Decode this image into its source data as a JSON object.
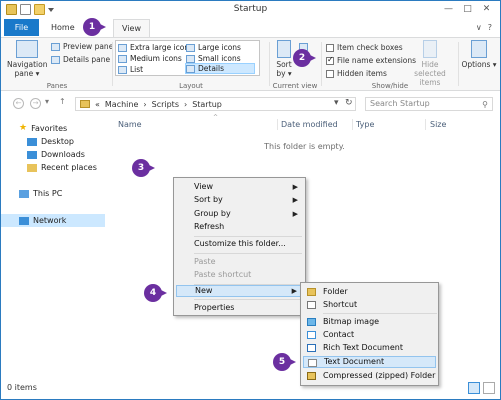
{
  "window": {
    "title": "Startup",
    "controls": {
      "minimize": "—",
      "maximize": "□",
      "close": "✕"
    }
  },
  "tabs": {
    "file": "File",
    "home": "Home",
    "view": "View"
  },
  "tabrow_right": {
    "collapse": "∨",
    "help": "?"
  },
  "ribbon": {
    "panes": {
      "label": "Panes",
      "navigation_pane": "Navigation pane",
      "navigation_pane_arrow": "▾",
      "preview_pane": "Preview pane",
      "details_pane": "Details pane"
    },
    "layout": {
      "label": "Layout",
      "extra_large_icons": "Extra large icons",
      "large_icons": "Large icons",
      "medium_icons": "Medium icons",
      "small_icons": "Small icons",
      "list": "List",
      "details": "Details"
    },
    "current_view": {
      "label": "Current view",
      "sort_by": "Sort by",
      "sort_arrow": "▾"
    },
    "show_hide": {
      "label": "Show/hide",
      "item_check_boxes": "Item check boxes",
      "file_name_extensions": "File name extensions",
      "hidden_items": "Hidden items",
      "hide_selected_items": "Hide selected items"
    },
    "options": {
      "label": "Options",
      "arrow": "▾"
    }
  },
  "address": {
    "back": "←",
    "forward": "→",
    "recent": "▾",
    "up": "↑",
    "chevron": "«",
    "crumbs": [
      "Machine",
      "Scripts",
      "Startup"
    ],
    "crumb_sep": "›",
    "dropdown": "▾",
    "refresh": "↻",
    "search_placeholder": "Search Startup",
    "search_icon": "⚲"
  },
  "nav": {
    "star": "★",
    "favorites": "Favorites",
    "desktop": "Desktop",
    "downloads": "Downloads",
    "recent_places": "Recent places",
    "this_pc": "This PC",
    "network": "Network"
  },
  "columns": {
    "name": "Name",
    "date_modified": "Date modified",
    "type": "Type",
    "size": "Size",
    "sort_indicator": "^"
  },
  "empty_message": "This folder is empty.",
  "context_menu": {
    "view": "View",
    "sort_by": "Sort by",
    "group_by": "Group by",
    "refresh": "Refresh",
    "customize": "Customize this folder...",
    "paste": "Paste",
    "paste_shortcut": "Paste shortcut",
    "new": "New",
    "properties": "Properties",
    "submenu_arrow": "▶"
  },
  "new_submenu": {
    "folder": "Folder",
    "shortcut": "Shortcut",
    "bitmap": "Bitmap image",
    "contact": "Contact",
    "rtf": "Rich Text Document",
    "text": "Text Document",
    "zip": "Compressed (zipped) Folder"
  },
  "badges": [
    "1",
    "2",
    "3",
    "4",
    "5"
  ],
  "status": {
    "items": "0 items"
  },
  "colors": {
    "accent": "#1979ca",
    "badge": "#6b2fa0",
    "highlight": "#d5e8f9"
  }
}
